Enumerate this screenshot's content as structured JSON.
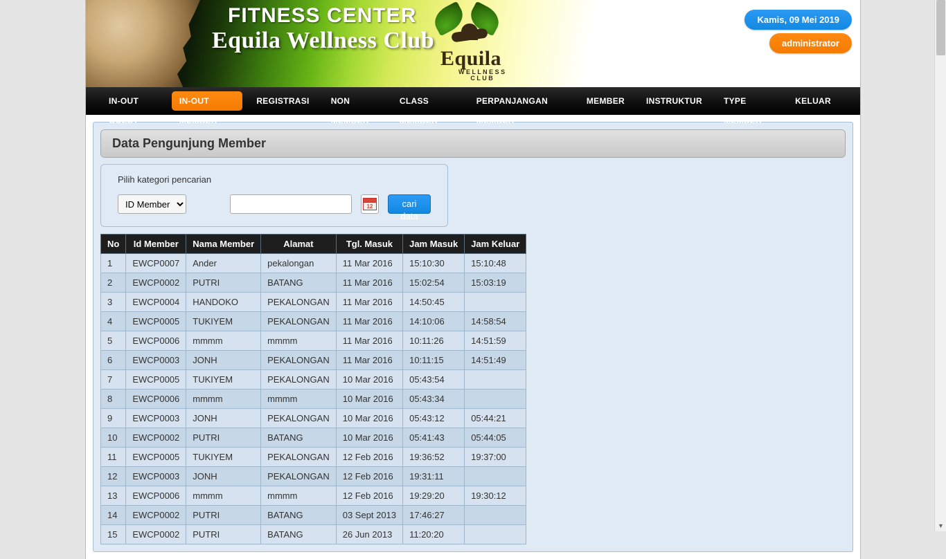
{
  "header": {
    "line1": "FITNESS CENTER",
    "line2": "Equila Wellness Club",
    "logo_main": "Equila",
    "logo_sub1": "W E L L N E S S",
    "logo_sub2": "C L U B",
    "date_pill": "Kamis, 09 Mei 2019",
    "user_pill": "administrator"
  },
  "nav": {
    "items": [
      "IN-OUT GUEST",
      "IN-OUT MEMBER",
      "REGISTRASI",
      "NON MEMBER",
      "CLASS MEMBER",
      "PERPANJANGAN MEMBER",
      "MEMBER",
      "INSTRUKTUR",
      "TYPE MEMBER",
      "KELUAR"
    ],
    "active_index": 1
  },
  "page": {
    "title": "Data Pengunjung Member",
    "search_label": "Pilih kategori pencarian",
    "search_select": "ID Member",
    "search_input": "",
    "search_button": "cari data"
  },
  "table": {
    "headers": [
      "No",
      "Id Member",
      "Nama Member",
      "Alamat",
      "Tgl. Masuk",
      "Jam Masuk",
      "Jam Keluar"
    ],
    "rows": [
      [
        "1",
        "EWCP0007",
        "Ander",
        "pekalongan",
        "11 Mar 2016",
        "15:10:30",
        "15:10:48"
      ],
      [
        "2",
        "EWCP0002",
        "PUTRI",
        "BATANG",
        "11 Mar 2016",
        "15:02:54",
        "15:03:19"
      ],
      [
        "3",
        "EWCP0004",
        "HANDOKO",
        "PEKALONGAN",
        "11 Mar 2016",
        "14:50:45",
        ""
      ],
      [
        "4",
        "EWCP0005",
        "TUKIYEM",
        "PEKALONGAN",
        "11 Mar 2016",
        "14:10:06",
        "14:58:54"
      ],
      [
        "5",
        "EWCP0006",
        "mmmm",
        "mmmm",
        "11 Mar 2016",
        "10:11:26",
        "14:51:59"
      ],
      [
        "6",
        "EWCP0003",
        "JONH",
        "PEKALONGAN",
        "11 Mar 2016",
        "10:11:15",
        "14:51:49"
      ],
      [
        "7",
        "EWCP0005",
        "TUKIYEM",
        "PEKALONGAN",
        "10 Mar 2016",
        "05:43:54",
        ""
      ],
      [
        "8",
        "EWCP0006",
        "mmmm",
        "mmmm",
        "10 Mar 2016",
        "05:43:34",
        ""
      ],
      [
        "9",
        "EWCP0003",
        "JONH",
        "PEKALONGAN",
        "10 Mar 2016",
        "05:43:12",
        "05:44:21"
      ],
      [
        "10",
        "EWCP0002",
        "PUTRI",
        "BATANG",
        "10 Mar 2016",
        "05:41:43",
        "05:44:05"
      ],
      [
        "11",
        "EWCP0005",
        "TUKIYEM",
        "PEKALONGAN",
        "12 Feb 2016",
        "19:36:52",
        "19:37:00"
      ],
      [
        "12",
        "EWCP0003",
        "JONH",
        "PEKALONGAN",
        "12 Feb 2016",
        "19:31:11",
        ""
      ],
      [
        "13",
        "EWCP0006",
        "mmmm",
        "mmmm",
        "12 Feb 2016",
        "19:29:20",
        "19:30:12"
      ],
      [
        "14",
        "EWCP0002",
        "PUTRI",
        "BATANG",
        "03 Sept 2013",
        "17:46:27",
        ""
      ],
      [
        "15",
        "EWCP0002",
        "PUTRI",
        "BATANG",
        "26 Jun 2013",
        "11:20:20",
        ""
      ]
    ]
  }
}
